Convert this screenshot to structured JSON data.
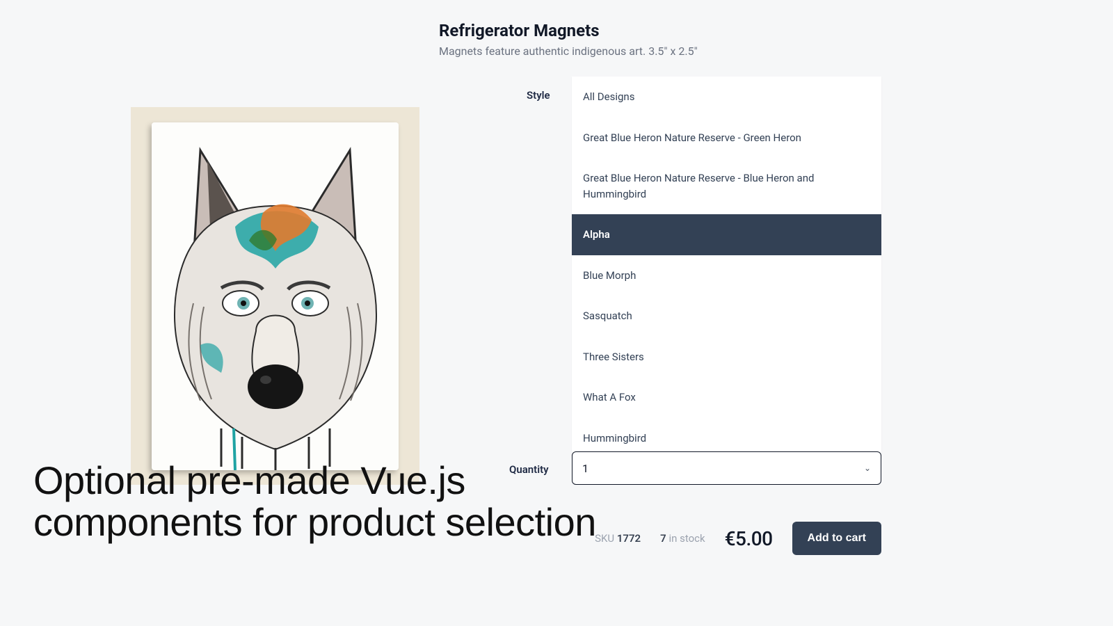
{
  "product": {
    "title": "Refrigerator Magnets",
    "subtitle": "Magnets feature authentic indigenous art. 3.5\" x 2.5\""
  },
  "labels": {
    "style": "Style",
    "quantity": "Quantity",
    "sku_prefix": "SKU",
    "stock_suffix": "in stock",
    "add_to_cart": "Add to cart"
  },
  "styles": [
    "All Designs",
    "Great Blue Heron Nature Reserve - Green Heron",
    "Great Blue Heron Nature Reserve - Blue Heron and Hummingbird",
    "Alpha",
    "Blue Morph",
    "Sasquatch",
    "Three Sisters",
    "What A Fox",
    "Hummingbird"
  ],
  "selected_style_index": 3,
  "quantity": "1",
  "sku": "1772",
  "stock": "7",
  "price": "€5.00",
  "caption_line1": "Optional pre-made Vue.js",
  "caption_line2": "components for product selection"
}
